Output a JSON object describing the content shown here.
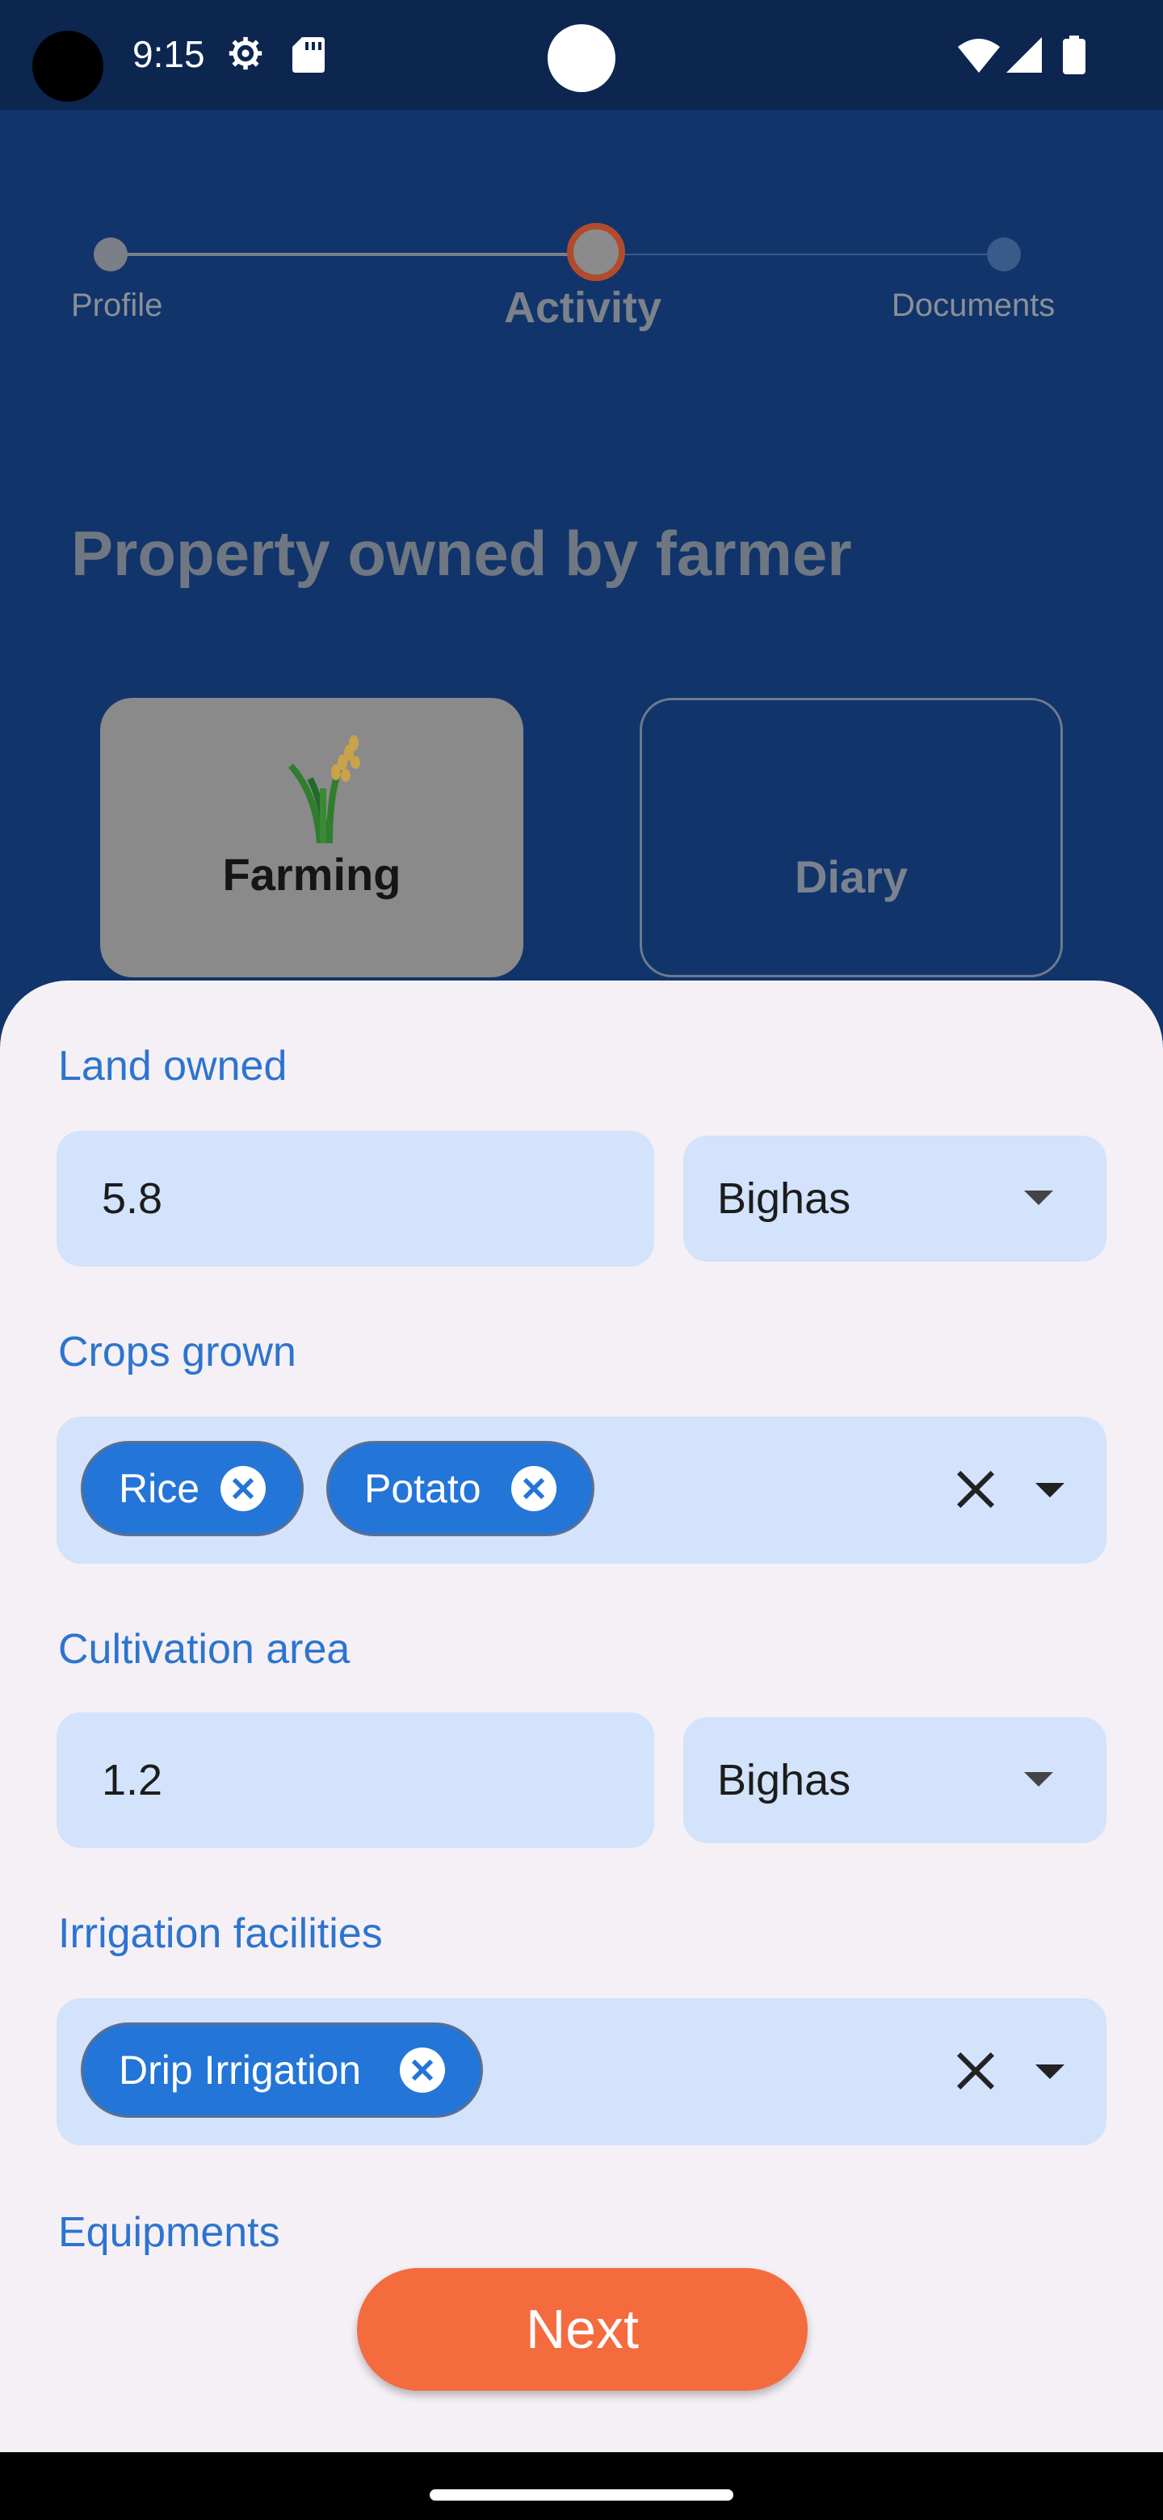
{
  "status_bar": {
    "time": "9:15"
  },
  "stepper": {
    "steps": [
      {
        "label": "Profile"
      },
      {
        "label": "Activity"
      },
      {
        "label": "Documents"
      }
    ]
  },
  "section_title": "Property owned by farmer",
  "cards": {
    "farming": "Farming",
    "diary": "Diary"
  },
  "form": {
    "land_owned": {
      "label": "Land owned",
      "value": "5.8",
      "unit": "Bighas"
    },
    "crops_grown": {
      "label": "Crops grown",
      "chips": [
        "Rice",
        "Potato"
      ]
    },
    "cultivation_area": {
      "label": "Cultivation area",
      "value": "1.2",
      "unit": "Bighas"
    },
    "irrigation": {
      "label": "Irrigation facilities",
      "chips": [
        "Drip Irrigation"
      ]
    },
    "equipments": {
      "label": "Equipments"
    }
  },
  "next_button": "Next",
  "colors": {
    "accent": "#f46b3e",
    "label_blue": "#2c74cf",
    "chip_blue": "#2375d8",
    "field_bg": "#d2e3fb",
    "header_bg": "#11346a"
  }
}
